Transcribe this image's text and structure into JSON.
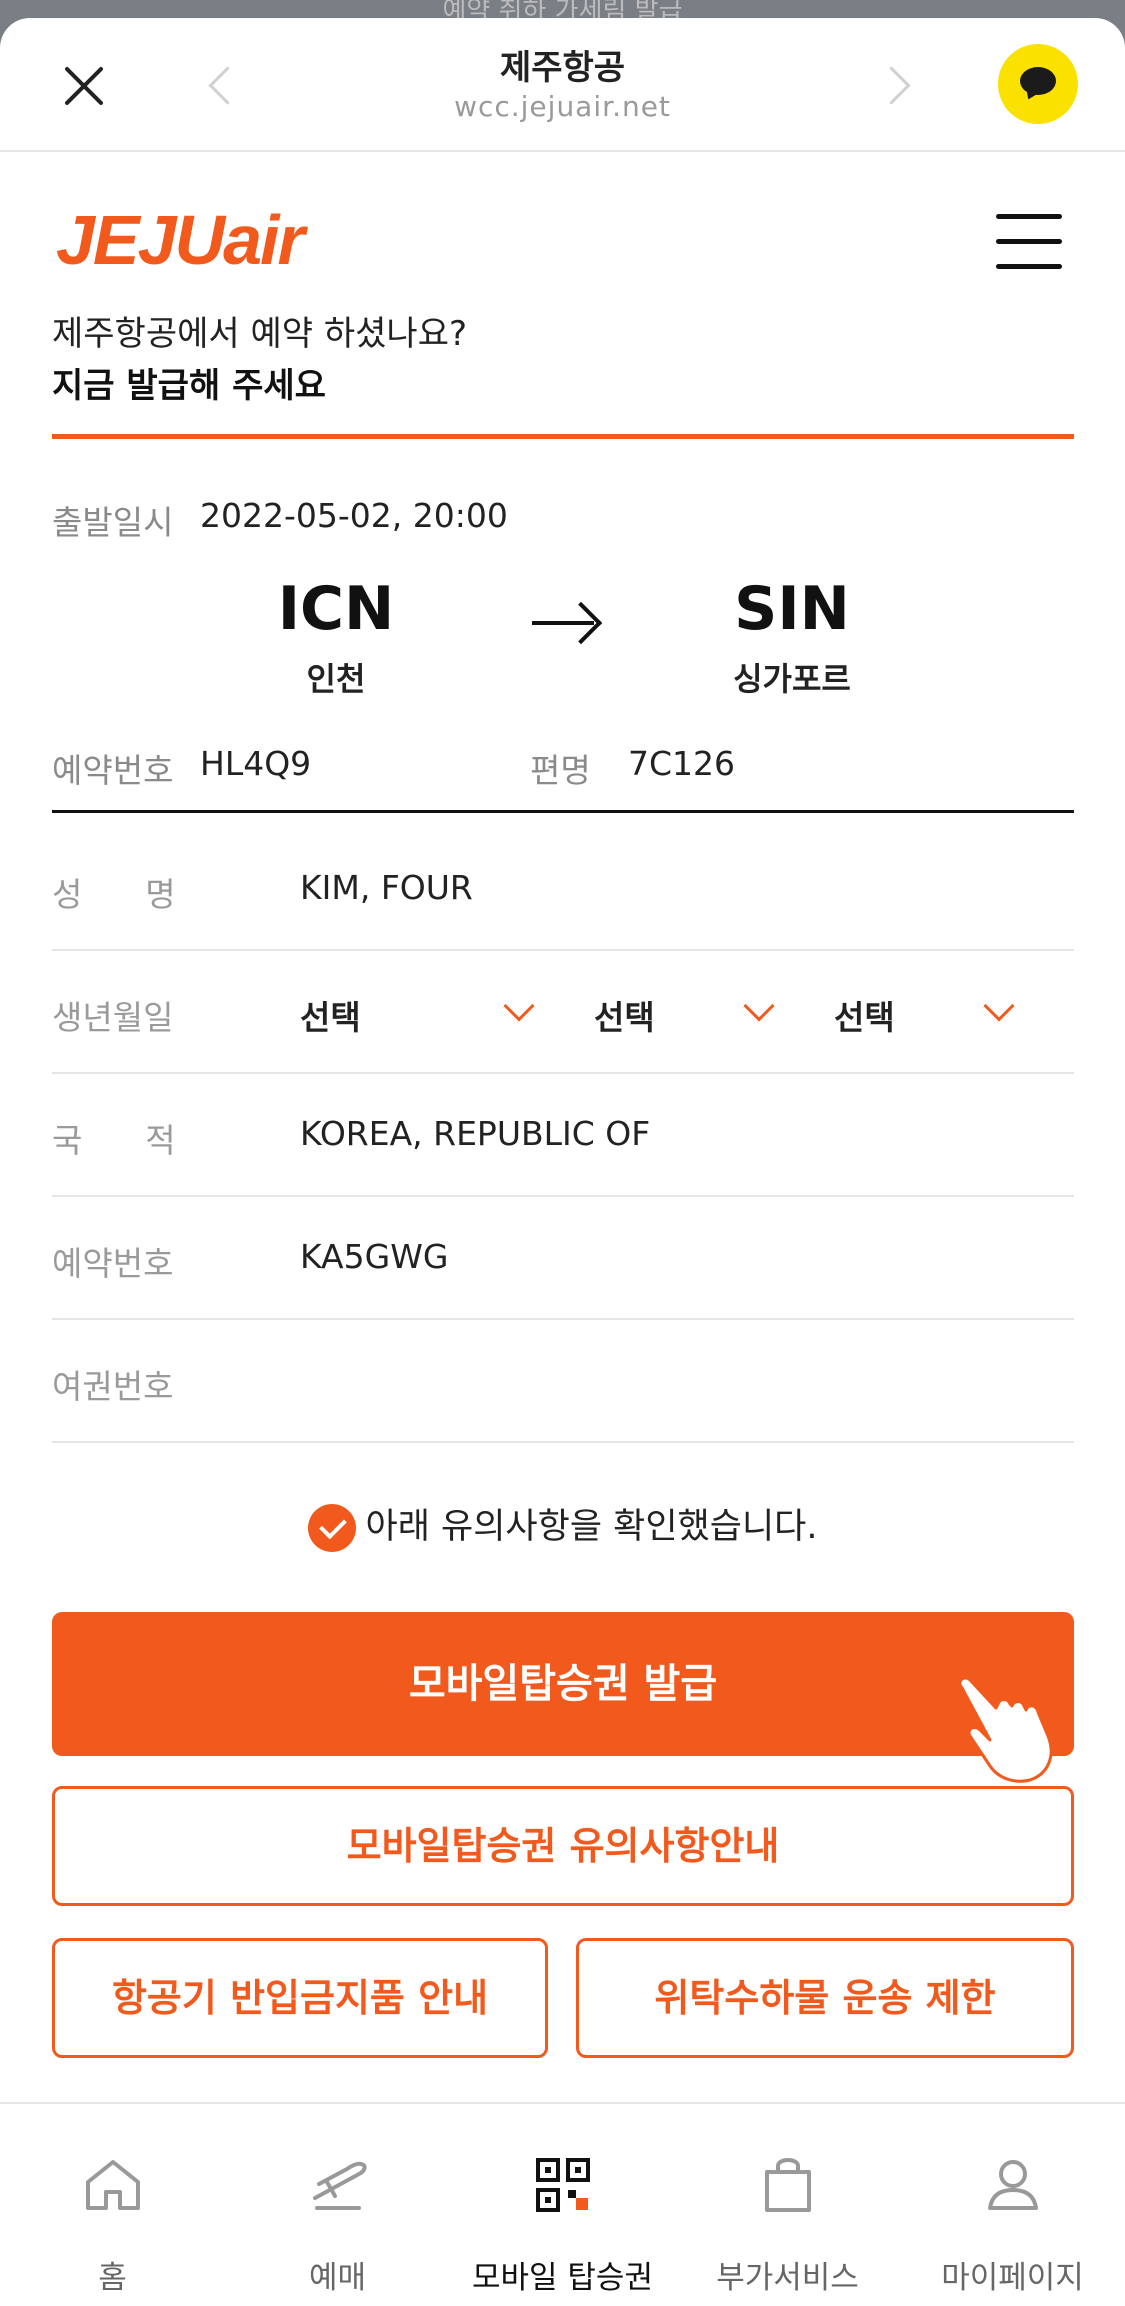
{
  "browser": {
    "peek_text": "예약 취하 가세림 발급",
    "title": "제주항공",
    "url": "wcc.jejuair.net"
  },
  "site": {
    "logo_text": "JEJUair",
    "question": "제주항공에서 예약 하셨나요?",
    "cta": "지금 발급해 주세요"
  },
  "flight": {
    "departure_label": "출발일시",
    "departure_value": "2022-05-02, 20:00",
    "origin_code": "ICN",
    "origin_city": "인천",
    "destination_code": "SIN",
    "destination_city": "싱가포르",
    "reservation_label": "예약번호",
    "reservation_value": "HL4Q9",
    "flight_label": "편명",
    "flight_value": "7C126"
  },
  "form": {
    "name_label": "성      명",
    "name_value": "KIM, FOUR",
    "birth_label": "생년월일",
    "birth_year": "선택",
    "birth_month": "선택",
    "birth_day": "선택",
    "nationality_label": "국      적",
    "nationality_value": "KOREA, REPUBLIC OF",
    "booking_label": "예약번호",
    "booking_value": "KA5GWG",
    "passport_label": "여권번호",
    "passport_value": ""
  },
  "agree_text": "아래 유의사항을 확인했습니다.",
  "buttons": {
    "issue": "모바일탑승권 발급",
    "notice": "모바일탑승권 유의사항안내",
    "prohibited": "항공기 반입금지품 안내",
    "baggage": "위탁수하물 운송 제한"
  },
  "nav": {
    "home": "홈",
    "booking": "예매",
    "boarding_pass": "모바일 탑승권",
    "extras": "부가서비스",
    "mypage": "마이페이지"
  },
  "colors": {
    "brand": "#f25a1d",
    "kakao": "#fae100"
  }
}
